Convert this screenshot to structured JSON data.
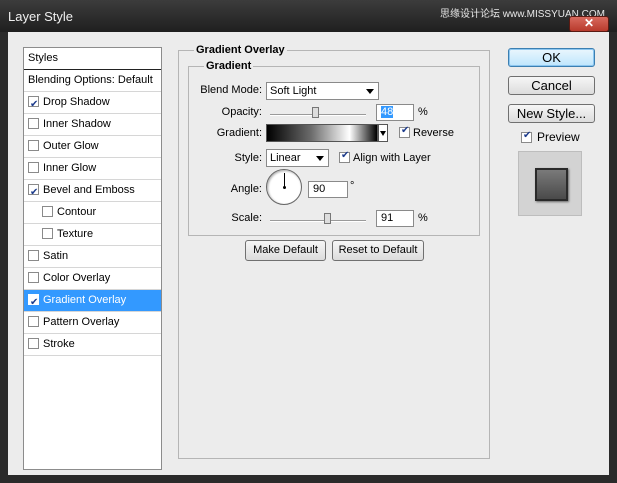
{
  "window": {
    "title": "Layer Style",
    "watermark": "思缘设计论坛 www.MISSYUAN.COM",
    "close_glyph": "✕"
  },
  "styles_list": {
    "items": [
      {
        "label": "Styles",
        "has_checkbox": false,
        "checked": false,
        "indent": false,
        "selected": false
      },
      {
        "label": "Blending Options: Default",
        "has_checkbox": false,
        "checked": false,
        "indent": false,
        "selected": false
      },
      {
        "label": "Drop Shadow",
        "has_checkbox": true,
        "checked": true,
        "indent": false,
        "selected": false
      },
      {
        "label": "Inner Shadow",
        "has_checkbox": true,
        "checked": false,
        "indent": false,
        "selected": false
      },
      {
        "label": "Outer Glow",
        "has_checkbox": true,
        "checked": false,
        "indent": false,
        "selected": false
      },
      {
        "label": "Inner Glow",
        "has_checkbox": true,
        "checked": false,
        "indent": false,
        "selected": false
      },
      {
        "label": "Bevel and Emboss",
        "has_checkbox": true,
        "checked": true,
        "indent": false,
        "selected": false
      },
      {
        "label": "Contour",
        "has_checkbox": true,
        "checked": false,
        "indent": true,
        "selected": false
      },
      {
        "label": "Texture",
        "has_checkbox": true,
        "checked": false,
        "indent": true,
        "selected": false
      },
      {
        "label": "Satin",
        "has_checkbox": true,
        "checked": false,
        "indent": false,
        "selected": false
      },
      {
        "label": "Color Overlay",
        "has_checkbox": true,
        "checked": false,
        "indent": false,
        "selected": false
      },
      {
        "label": "Gradient Overlay",
        "has_checkbox": true,
        "checked": true,
        "indent": false,
        "selected": true
      },
      {
        "label": "Pattern Overlay",
        "has_checkbox": true,
        "checked": false,
        "indent": false,
        "selected": false
      },
      {
        "label": "Stroke",
        "has_checkbox": true,
        "checked": false,
        "indent": false,
        "selected": false
      }
    ]
  },
  "gradient_overlay": {
    "section_title": "Gradient Overlay",
    "group_title": "Gradient",
    "blend_mode": {
      "label": "Blend Mode:",
      "value": "Soft Light"
    },
    "opacity": {
      "label": "Opacity:",
      "value": "48",
      "unit": "%",
      "fraction": 0.48
    },
    "gradient": {
      "label": "Gradient:",
      "reverse_label": "Reverse",
      "reverse_checked": true
    },
    "style": {
      "label": "Style:",
      "value": "Linear",
      "align_label": "Align with Layer",
      "align_checked": true
    },
    "angle": {
      "label": "Angle:",
      "value": "90",
      "unit": "°"
    },
    "scale": {
      "label": "Scale:",
      "value": "91",
      "unit": "%",
      "fraction": 0.6
    },
    "make_default_label": "Make Default",
    "reset_default_label": "Reset to Default"
  },
  "actions": {
    "ok_label": "OK",
    "cancel_label": "Cancel",
    "new_style_label": "New Style...",
    "preview_label": "Preview",
    "preview_checked": true
  }
}
